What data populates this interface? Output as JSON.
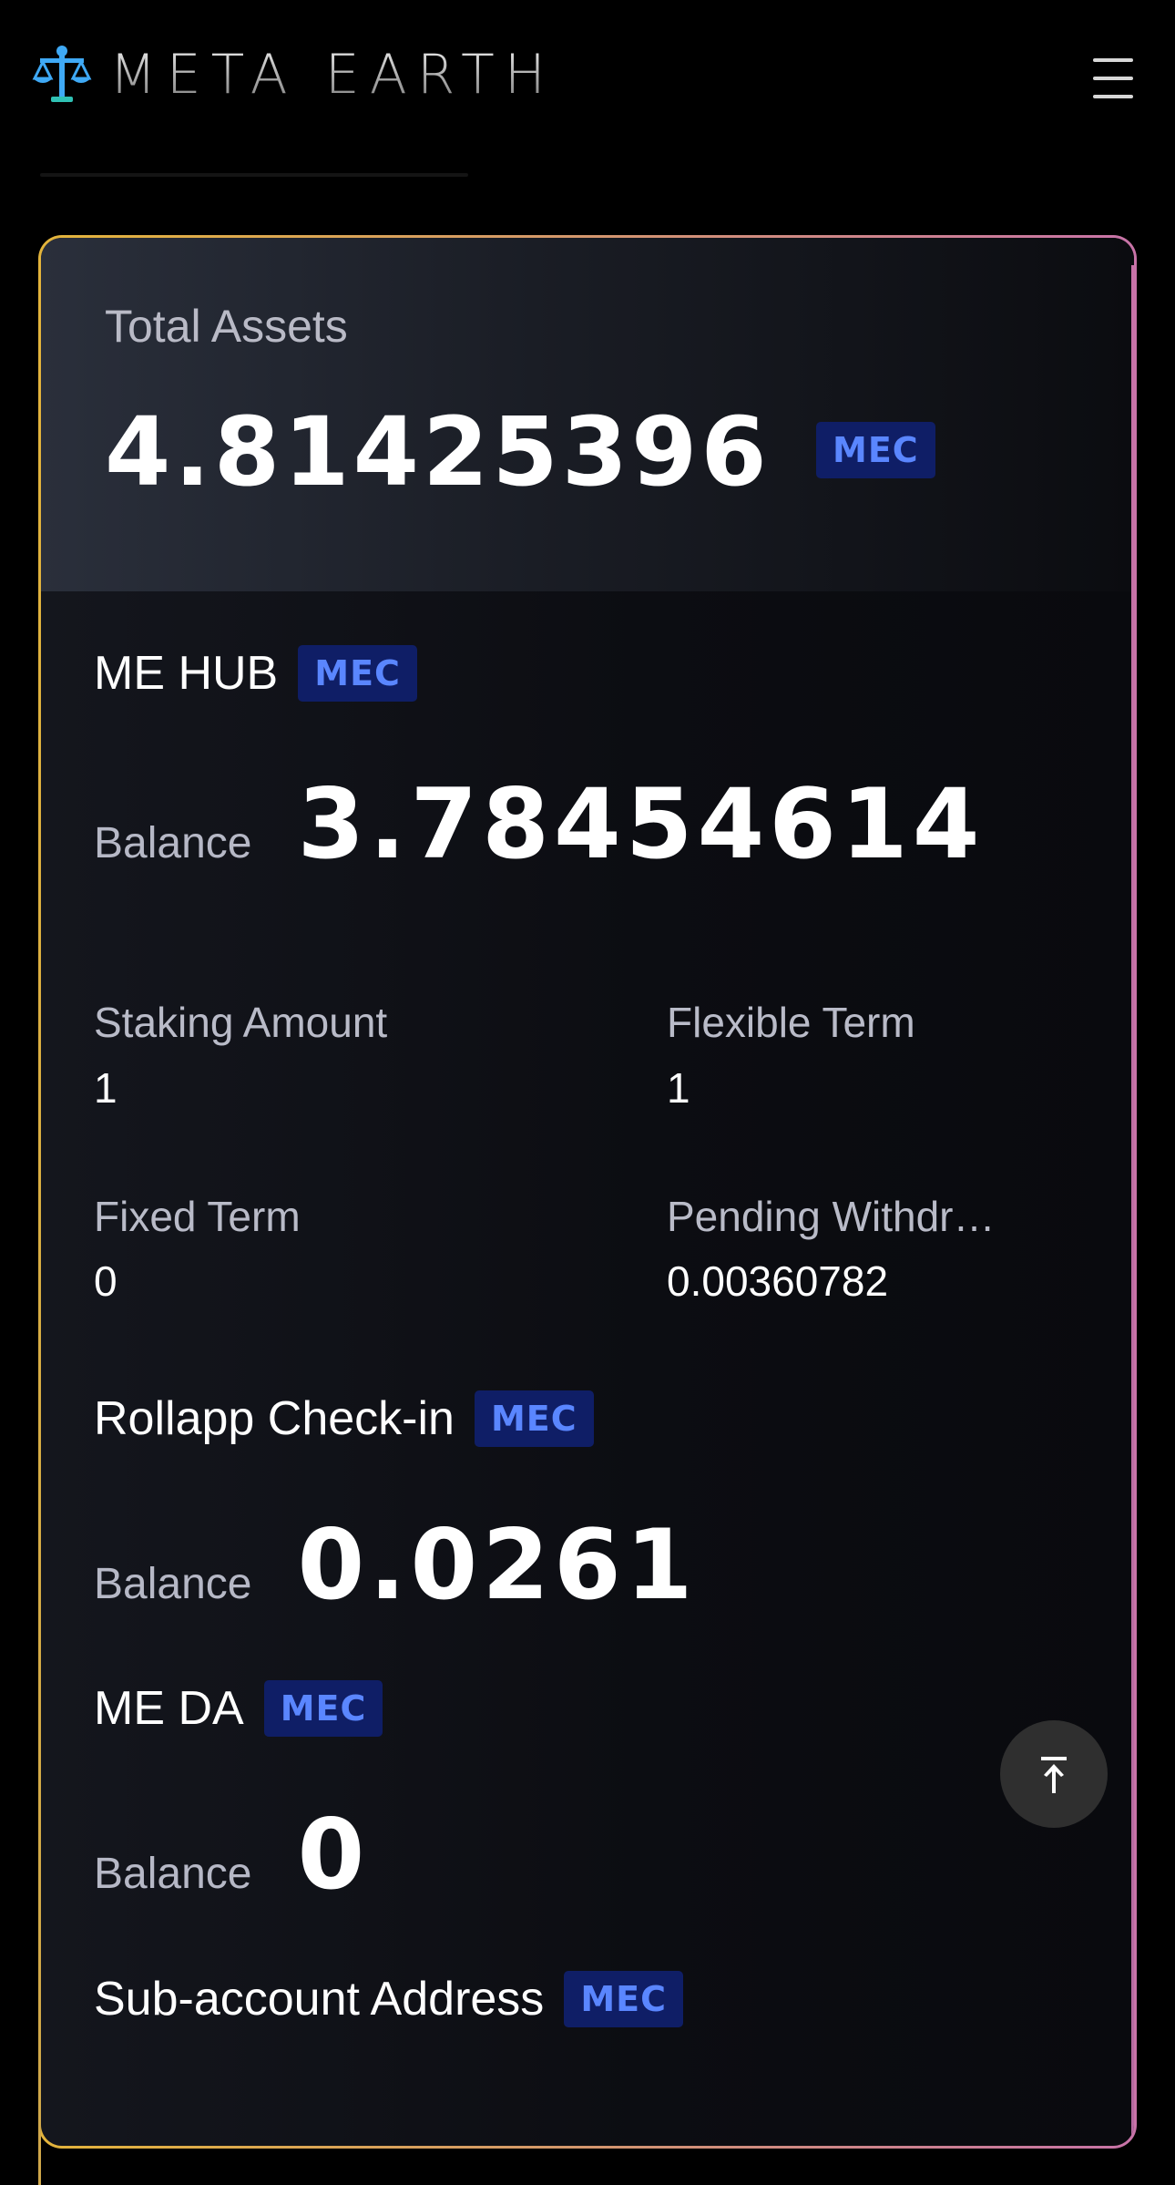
{
  "header": {
    "brand": "META EARTH",
    "menu_icon": "hamburger-menu-icon",
    "logo_icon": "scales-logo-icon",
    "accent_color": "#3fa9f5"
  },
  "total_assets": {
    "label": "Total Assets",
    "value": "4.81425396",
    "unit": "MEC"
  },
  "me_hub": {
    "title": "ME HUB",
    "unit": "MEC",
    "balance_label": "Balance",
    "balance": "3.78454614",
    "stats": [
      {
        "label": "Staking Amount",
        "value": "1"
      },
      {
        "label": "Flexible Term",
        "value": "1"
      },
      {
        "label": "Fixed Term",
        "value": "0"
      },
      {
        "label": "Pending Withdr…",
        "value": "0.00360782"
      }
    ]
  },
  "rollapp": {
    "title": "Rollapp Check-in",
    "unit": "MEC",
    "balance_label": "Balance",
    "balance": "0.0261"
  },
  "me_da": {
    "title": "ME DA",
    "unit": "MEC",
    "balance_label": "Balance",
    "balance": "0"
  },
  "sub_account": {
    "title": "Sub-account Address",
    "unit": "MEC"
  },
  "colors": {
    "badge_bg": "#0f1e66",
    "badge_text": "#5a86ff",
    "card_border_left": "#e3b43b",
    "card_border_right": "#c873a8"
  },
  "back_to_top_icon": "arrow-up-to-line-icon"
}
